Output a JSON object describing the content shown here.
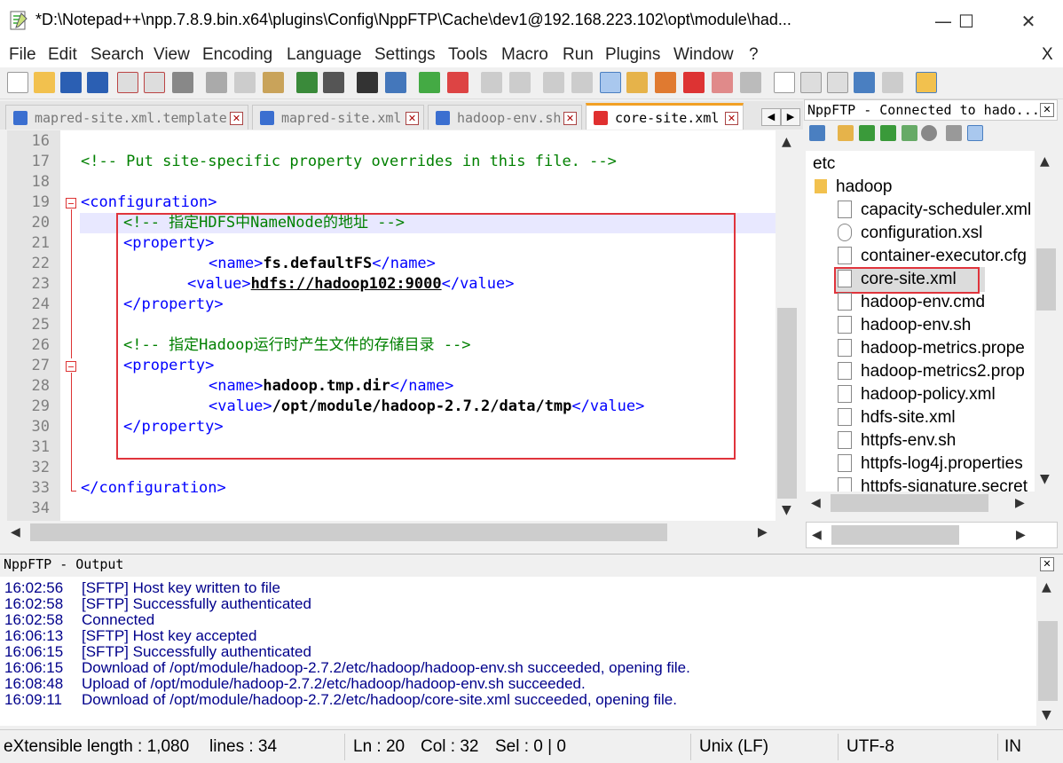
{
  "window": {
    "title": "*D:\\Notepad++\\npp.7.8.9.bin.x64\\plugins\\Config\\NppFTP\\Cache\\dev1@192.168.223.102\\opt\\module\\had...",
    "minimize": "—",
    "maximize": "☐",
    "close": "✕"
  },
  "menu": {
    "items": [
      "File",
      "Edit",
      "Search",
      "View",
      "Encoding",
      "Language",
      "Settings",
      "Tools",
      "Macro",
      "Run",
      "Plugins",
      "Window",
      "?"
    ],
    "close": "X"
  },
  "tabs": [
    {
      "label": "mapred-site.xml.template",
      "icon_color": "#3b6fd0"
    },
    {
      "label": "mapred-site.xml",
      "icon_color": "#3b6fd0"
    },
    {
      "label": "hadoop-env.sh",
      "icon_color": "#3b6fd0"
    },
    {
      "label": "core-site.xml",
      "icon_color": "#e03030"
    }
  ],
  "tab_close": "✕",
  "tab_nav": {
    "left": "◀",
    "right": "▶",
    "close": "✕"
  },
  "editor": {
    "line_numbers": [
      "16",
      "17",
      "18",
      "19",
      "20",
      "21",
      "22",
      "23",
      "24",
      "25",
      "26",
      "27",
      "28",
      "29",
      "30",
      "31",
      "32",
      "33",
      "34"
    ],
    "lines": {
      "l17": "<!-- Put site-specific property overrides in this file. -->",
      "l19": "<configuration>",
      "l20": "<!-- 指定HDFS中NameNode的地址 -->",
      "l21": "<property>",
      "l22_open": "<name>",
      "l22_val": "fs.defaultFS",
      "l22_close": "</name>",
      "l23_open": "<value>",
      "l23_val": "hdfs://hadoop102:9000",
      "l23_close": "</value>",
      "l24": "</property>",
      "l26": "<!-- 指定Hadoop运行时产生文件的存储目录 -->",
      "l27": "<property>",
      "l28_open": "<name>",
      "l28_val": "hadoop.tmp.dir",
      "l28_close": "</name>",
      "l29_open": "<value>",
      "l29_val": "/opt/module/hadoop-2.7.2/data/tmp",
      "l29_close": "</value>",
      "l30": "</property>",
      "l33": "</configuration>"
    }
  },
  "ftp": {
    "title": "NppFTP - Connected to hado...",
    "close": "✕",
    "root": "etc",
    "folder": "hadoop",
    "files": [
      "capacity-scheduler.xml",
      "configuration.xsl",
      "container-executor.cfg",
      "core-site.xml",
      "hadoop-env.cmd",
      "hadoop-env.sh",
      "hadoop-metrics.prope",
      "hadoop-metrics2.prop",
      "hadoop-policy.xml",
      "hdfs-site.xml",
      "httpfs-env.sh",
      "httpfs-log4j.properties",
      "httpfs-signature.secret"
    ]
  },
  "output": {
    "title": "NppFTP - Output",
    "close": "✕",
    "log": [
      {
        "time": "16:02:56",
        "msg": "[SFTP] Host key written to file"
      },
      {
        "time": "16:02:58",
        "msg": "[SFTP] Successfully authenticated"
      },
      {
        "time": "16:02:58",
        "msg": "Connected"
      },
      {
        "time": "16:06:13",
        "msg": "[SFTP] Host key accepted"
      },
      {
        "time": "16:06:15",
        "msg": "[SFTP] Successfully authenticated"
      },
      {
        "time": "16:06:15",
        "msg": "Download of /opt/module/hadoop-2.7.2/etc/hadoop/hadoop-env.sh succeeded, opening file."
      },
      {
        "time": "16:08:48",
        "msg": "Upload of /opt/module/hadoop-2.7.2/etc/hadoop/hadoop-env.sh succeeded."
      },
      {
        "time": "16:09:11",
        "msg": "Download of /opt/module/hadoop-2.7.2/etc/hadoop/core-site.xml succeeded, opening file."
      }
    ]
  },
  "status": {
    "lang": "eXtensible",
    "length": "length : 1,080",
    "lines": "lines : 34",
    "ln": "Ln : 20",
    "col": "Col : 32",
    "sel": "Sel : 0 | 0",
    "eol": "Unix (LF)",
    "enc": "UTF-8",
    "ins": "INS"
  },
  "colors": {
    "comment": "#008000",
    "tag": "#0000ff",
    "highlight_box": "#e0343c",
    "log_text": "#00008b",
    "fold_marker": "#d33"
  }
}
